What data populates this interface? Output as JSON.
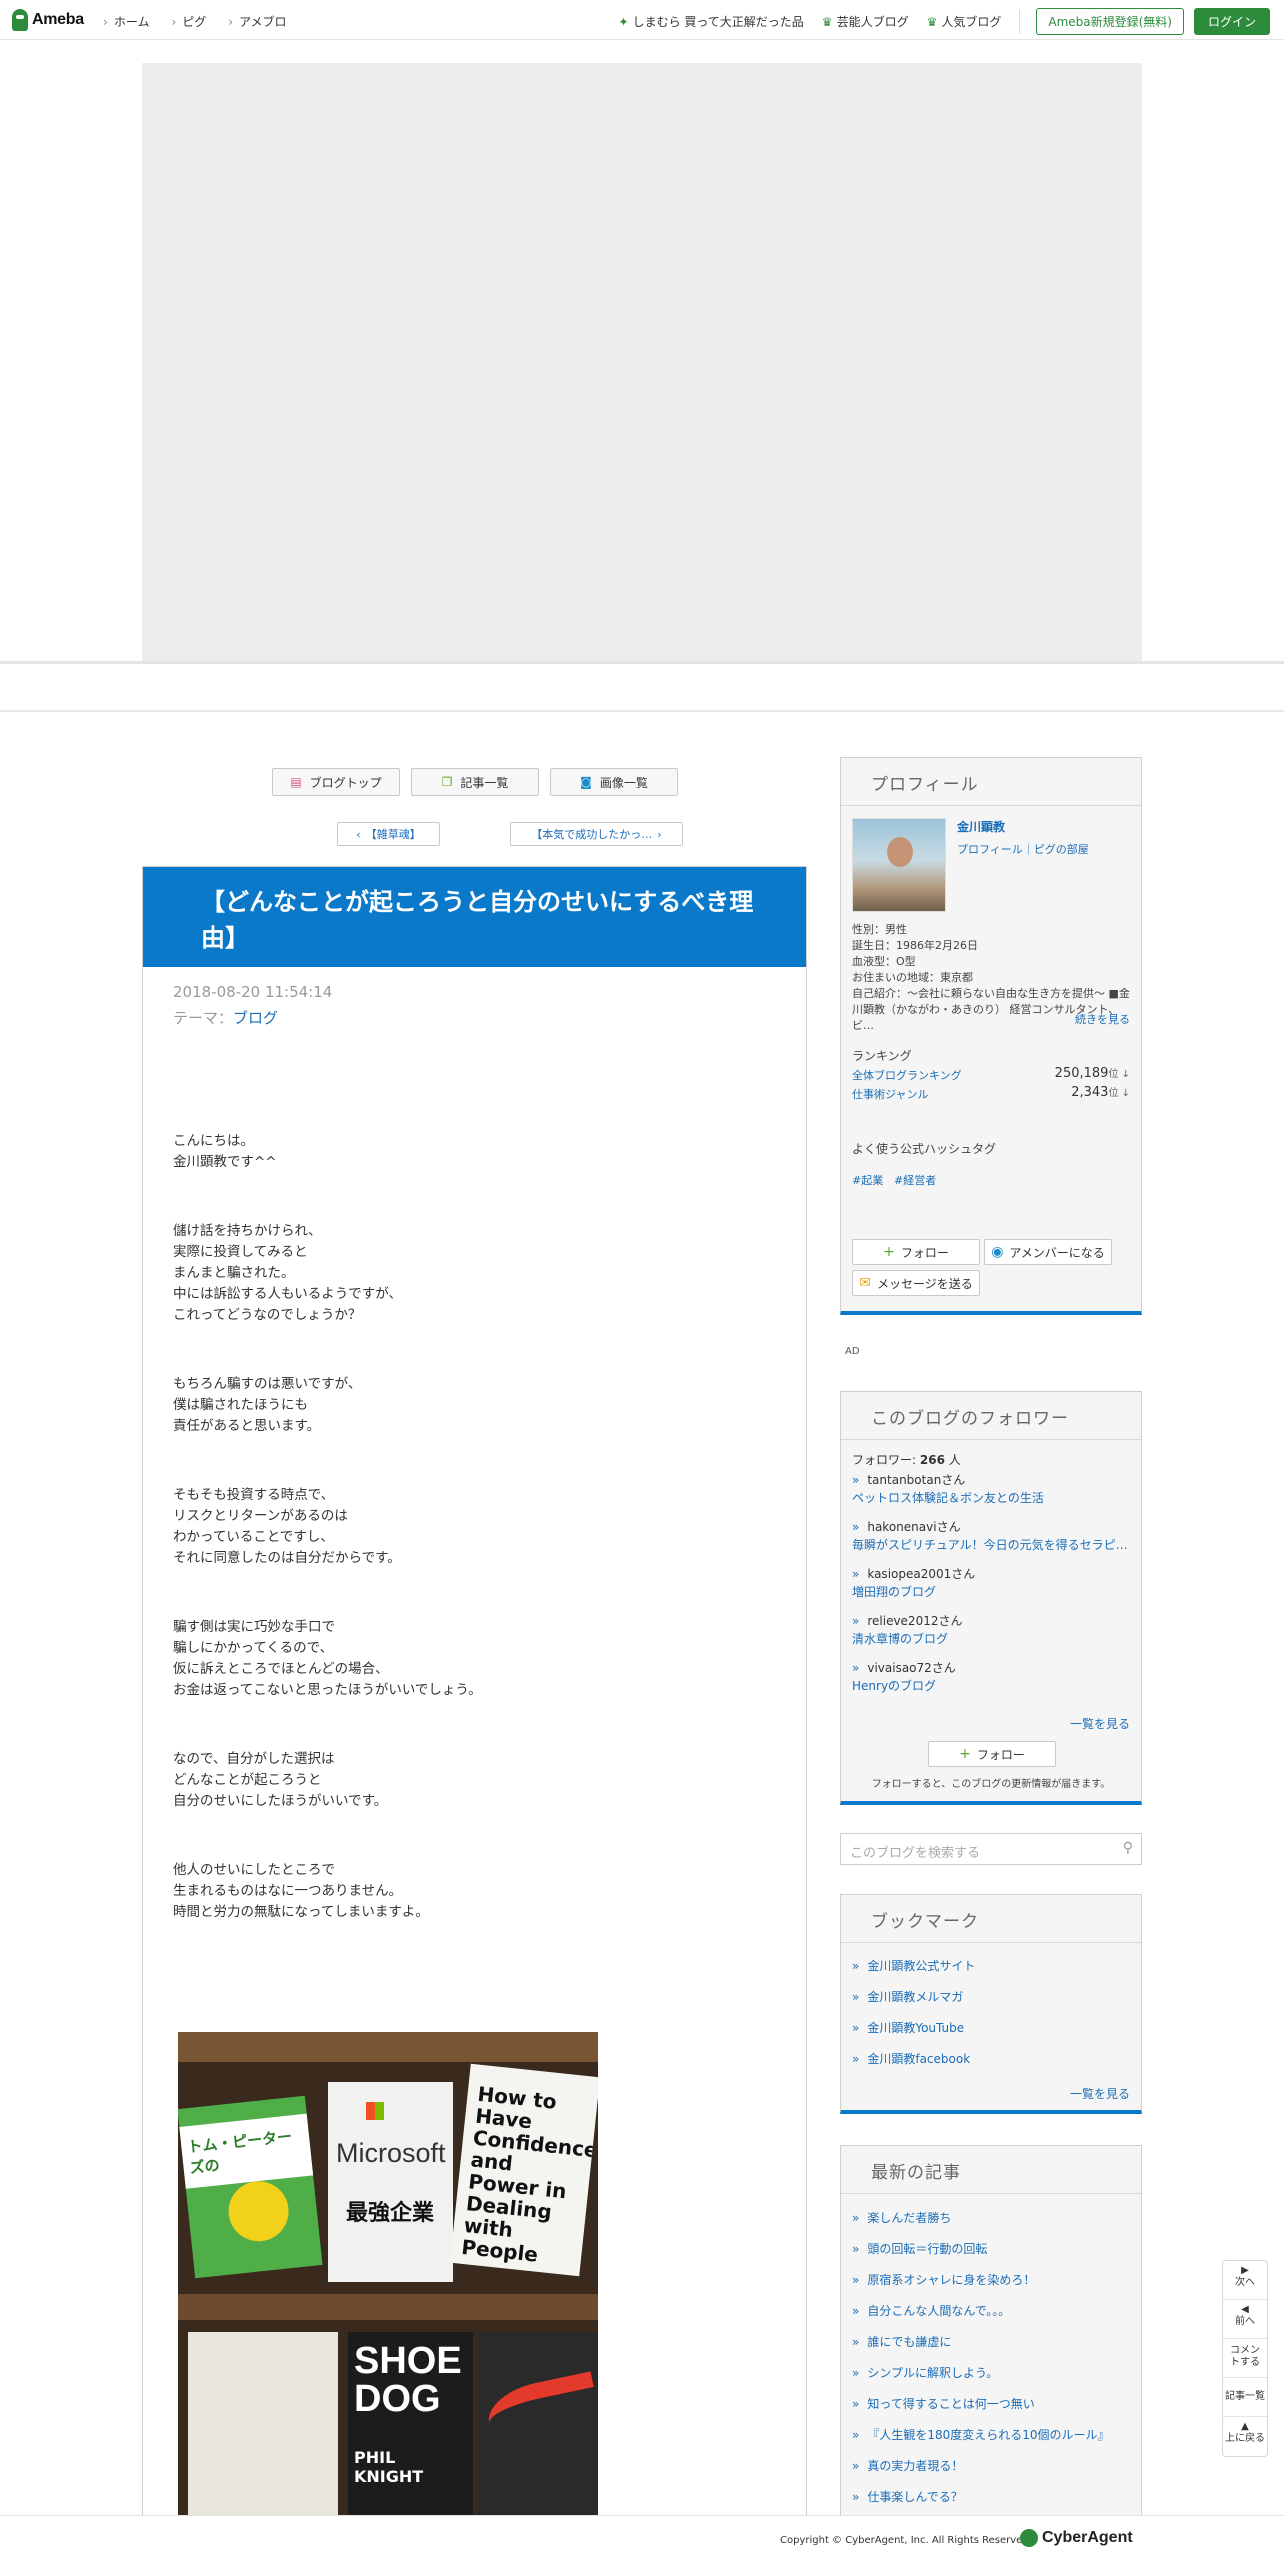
{
  "header": {
    "logo": "Ameba",
    "nav": [
      "ホーム",
      "ピグ",
      "アメブロ"
    ],
    "links": [
      {
        "icon": "sparkle-icon",
        "label": "しまむら 買って大正解だった品"
      },
      {
        "icon": "crown-icon",
        "label": "芸能人ブログ"
      },
      {
        "icon": "crown-icon",
        "label": "人気ブログ"
      }
    ],
    "register_label": "Ameba新規登録(無料)",
    "login_label": "ログイン"
  },
  "blog_nav": {
    "top": "ブログトップ",
    "entries": "記事一覧",
    "images": "画像一覧",
    "prev": "【雑草魂】",
    "next": "【本気で成功したかっ…"
  },
  "article": {
    "title": "【どんなことが起ころうと自分のせいにするべき理由】",
    "date": "2018-08-20 11:54:14",
    "theme_label": "テーマ：",
    "theme": "ブログ",
    "paragraphs": [
      [
        "こんにちは。",
        "金川顕教です^^"
      ],
      [
        "儲け話を持ちかけられ、",
        "実際に投資してみると",
        "まんまと騙された。",
        "中には訴訟する人もいるようですが、",
        "これってどうなのでしょうか？"
      ],
      [
        "もちろん騙すのは悪いですが、",
        "僕は騙されたほうにも",
        "責任があると思います。"
      ],
      [
        "そもそも投資する時点で、",
        "リスクとリターンがあるのは",
        "わかっていることですし、",
        "それに同意したのは自分だからです。"
      ],
      [
        "騙す側は実に巧妙な手口で",
        "騙しにかかってくるので、",
        "仮に訴えところでほとんどの場合、",
        "お金は返ってこないと思ったほうがいいでしょう。"
      ],
      [
        "なので、自分がした選択は",
        "どんなことが起ころうと",
        "自分のせいにしたほうがいいです。"
      ],
      [
        "他人のせいにしたところで",
        "生まれるものはなに一つありません。",
        "時間と労力の無駄になってしまいますよ。"
      ]
    ],
    "photo_books": [
      {
        "title": "トム・ピーターズの",
        "color": "#4fae48"
      },
      {
        "title": "Microsoft",
        "sub": "最強企業",
        "color": "#f1f1ef"
      },
      {
        "title": "How to Have Confidence and Power in Dealing with People",
        "color": "#f4f4f0"
      },
      {
        "title": "SHOE DOG",
        "sub": "PHIL KNIGHT",
        "color": "#1c1c1c"
      }
    ]
  },
  "profile": {
    "heading": "プロフィール",
    "name": "金川顕教",
    "links": "プロフィール｜ピグの部屋",
    "gender": "性別：男性",
    "birthday": "誕生日：1986年2月26日",
    "blood": "血液型：O型",
    "area": "お住まいの地域：東京都",
    "intro": "自己紹介：〜会社に頼らない自由な生き方を提供〜 ■金川顕教（かながわ・あきのり） 経営コンサルタント、ビ…",
    "more": "続きを見る",
    "ranking_label": "ランキング",
    "rankings": [
      {
        "label": "全体ブログランキング",
        "value": "250,189",
        "unit": "位 ↓"
      },
      {
        "label": "仕事術ジャンル",
        "value": "2,343",
        "unit": "位 ↓"
      }
    ],
    "hashtag_label": "よく使う公式ハッシュタグ",
    "hashtags": [
      "#起業",
      "#経営者"
    ],
    "follow": "フォロー",
    "member": "アメンバーになる",
    "message": "メッセージを送る"
  },
  "ad_label": "AD",
  "followers": {
    "heading": "このブログのフォロワー",
    "count_label": "フォロワー:",
    "count": "266",
    "count_unit": "人",
    "items": [
      {
        "name": "tantanbotan",
        "suffix": "さん",
        "blog": "ペットロス体験記＆ボン友との生活"
      },
      {
        "name": "hakonenavi",
        "suffix": "さん",
        "blog": "毎瞬がスピリチュアル！今日の元気を得るセラピ…"
      },
      {
        "name": "kasiopea2001",
        "suffix": "さん",
        "blog": "増田翔のブログ"
      },
      {
        "name": "relieve2012",
        "suffix": "さん",
        "blog": "清水章博のブログ"
      },
      {
        "name": "vivaisao72",
        "suffix": "さん",
        "blog": "Henryのブログ"
      }
    ],
    "more": "一覧を見る",
    "follow": "フォロー",
    "note": "フォローすると、このブログの更新情報が届きます。"
  },
  "search": {
    "placeholder": "このブログを検索する"
  },
  "bookmarks": {
    "heading": "ブックマーク",
    "items": [
      "金川顕教公式サイト",
      "金川顕教メルマガ",
      "金川顕教YouTube",
      "金川顕教facebook"
    ],
    "more": "一覧を見る"
  },
  "recent": {
    "heading": "最新の記事",
    "items": [
      "楽しんだ者勝ち",
      "頭の回転＝行動の回転",
      "原宿系オシャレに身を染めろ！",
      "自分こんな人間なんで。。。",
      "誰にでも謙虚に",
      "シンプルに解釈しよう。",
      "知って得することは何一つ無い",
      "『人生観を180度変えられる10個のルール』",
      "真の実力者現る！",
      "仕事楽しんでる？"
    ]
  },
  "floatnav": [
    "次へ",
    "前へ",
    "コメントする",
    "記事一覧",
    "上に戻る"
  ],
  "footer": {
    "copyright": "Copyright © CyberAgent, Inc. All Rights Reserved.",
    "brand": "CyberAgent"
  }
}
